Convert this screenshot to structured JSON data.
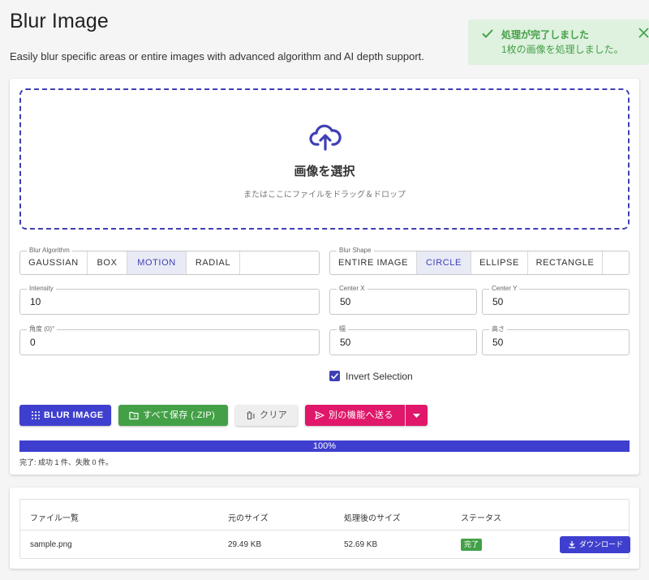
{
  "page": {
    "title": "Blur Image",
    "subtitle": "Easily blur specific areas or entire images with advanced algorithm and AI depth support."
  },
  "toast": {
    "title": "処理が完了しました",
    "message": "1枚の画像を処理しました。",
    "icon": "check-icon",
    "color": "#43a047"
  },
  "dropzone": {
    "title": "画像を選択",
    "hint": "またはここにファイルをドラッグ＆ドロップ",
    "icon": "cloud-upload-icon"
  },
  "blur_algorithm": {
    "label": "Blur Algorithm",
    "options": [
      "GAUSSIAN",
      "BOX",
      "MOTION",
      "RADIAL"
    ],
    "selected": "MOTION"
  },
  "blur_shape": {
    "label": "Blur Shape",
    "options": [
      "ENTIRE IMAGE",
      "CIRCLE",
      "ELLIPSE",
      "RECTANGLE"
    ],
    "selected": "CIRCLE"
  },
  "fields": {
    "intensity": {
      "label": "Intensity",
      "value": "10"
    },
    "center_x": {
      "label": "Center X",
      "value": "50"
    },
    "center_y": {
      "label": "Center Y",
      "value": "50"
    },
    "angle": {
      "label": "角度 (0)°",
      "value": "0"
    },
    "width": {
      "label": "幅",
      "value": "50"
    },
    "height": {
      "label": "高さ",
      "value": "50"
    }
  },
  "invert_selection": {
    "label": "Invert Selection",
    "checked": true
  },
  "actions": {
    "blur": "BLUR IMAGE",
    "save_zip": "すべて保存 (.ZIP)",
    "clear": "クリア",
    "send": "別の機能へ送る"
  },
  "progress": {
    "value_percent": 100,
    "label": "100%",
    "status": "完了: 成功 1 件、失敗 0 件。"
  },
  "file_table": {
    "headers": [
      "ファイル一覧",
      "元のサイズ",
      "処理後のサイズ",
      "ステータス"
    ],
    "rows": [
      {
        "name": "sample.png",
        "original_size": "29.49 KB",
        "processed_size": "52.69 KB",
        "status": "完了",
        "action": "ダウンロード"
      }
    ]
  },
  "colors": {
    "primary": "#3f3fcf",
    "success": "#43a047",
    "accent_pink": "#e0176a",
    "selected_bg": "#e8eaf6"
  }
}
